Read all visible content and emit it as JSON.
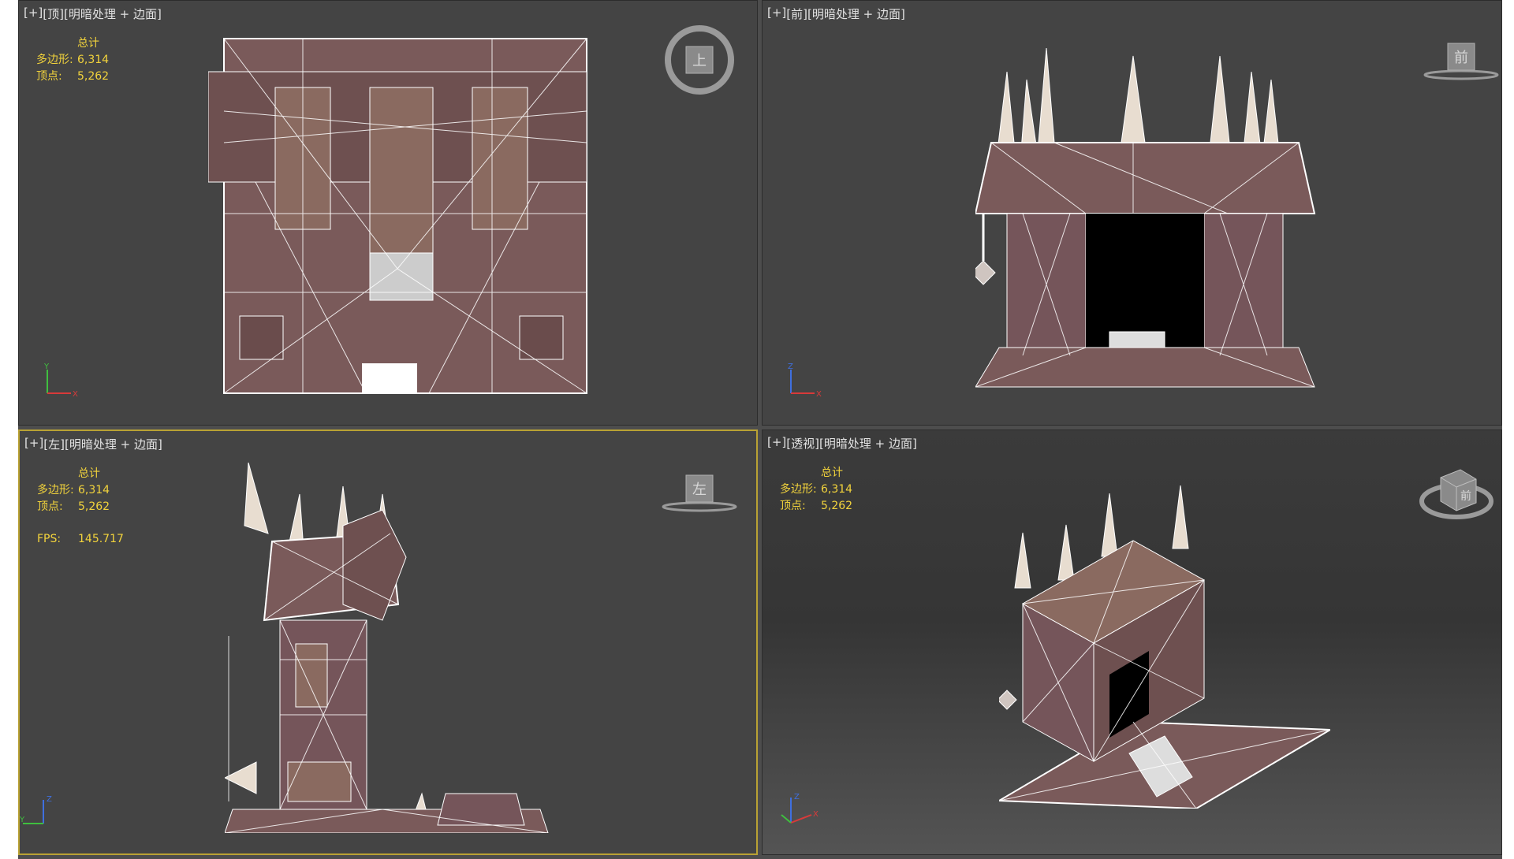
{
  "viewports": [
    {
      "plus": "[+]",
      "view": "[顶]",
      "mode": "[明暗处理 + 边面]",
      "stats_title": "总计",
      "poly_label": "多边形:",
      "poly_value": "6,314",
      "vert_label": "顶点:",
      "vert_value": "5,262",
      "cube_label": "上",
      "axis_h": "X",
      "axis_v": "Y"
    },
    {
      "plus": "[+]",
      "view": "[前]",
      "mode": "[明暗处理 + 边面]",
      "cube_label": "前",
      "axis_h": "X",
      "axis_v": "Z"
    },
    {
      "plus": "[+]",
      "view": "[左]",
      "mode": "[明暗处理 + 边面]",
      "stats_title": "总计",
      "poly_label": "多边形:",
      "poly_value": "6,314",
      "vert_label": "顶点:",
      "vert_value": "5,262",
      "fps_label": "FPS:",
      "fps_value": "145.717",
      "cube_label": "左",
      "axis_h": "Y",
      "axis_v": "Z"
    },
    {
      "plus": "[+]",
      "view": "[透视]",
      "mode": "[明暗处理 + 边面]",
      "stats_title": "总计",
      "poly_label": "多边形:",
      "poly_value": "6,314",
      "vert_label": "顶点:",
      "vert_value": "5,262",
      "cube_label": "前",
      "axis_h": "X",
      "axis_v": "Z"
    }
  ],
  "colors": {
    "stat_text": "#f2d33c",
    "active_border": "#b9a234",
    "wire": "#ffffff",
    "mesh": "#7a5a5a"
  }
}
